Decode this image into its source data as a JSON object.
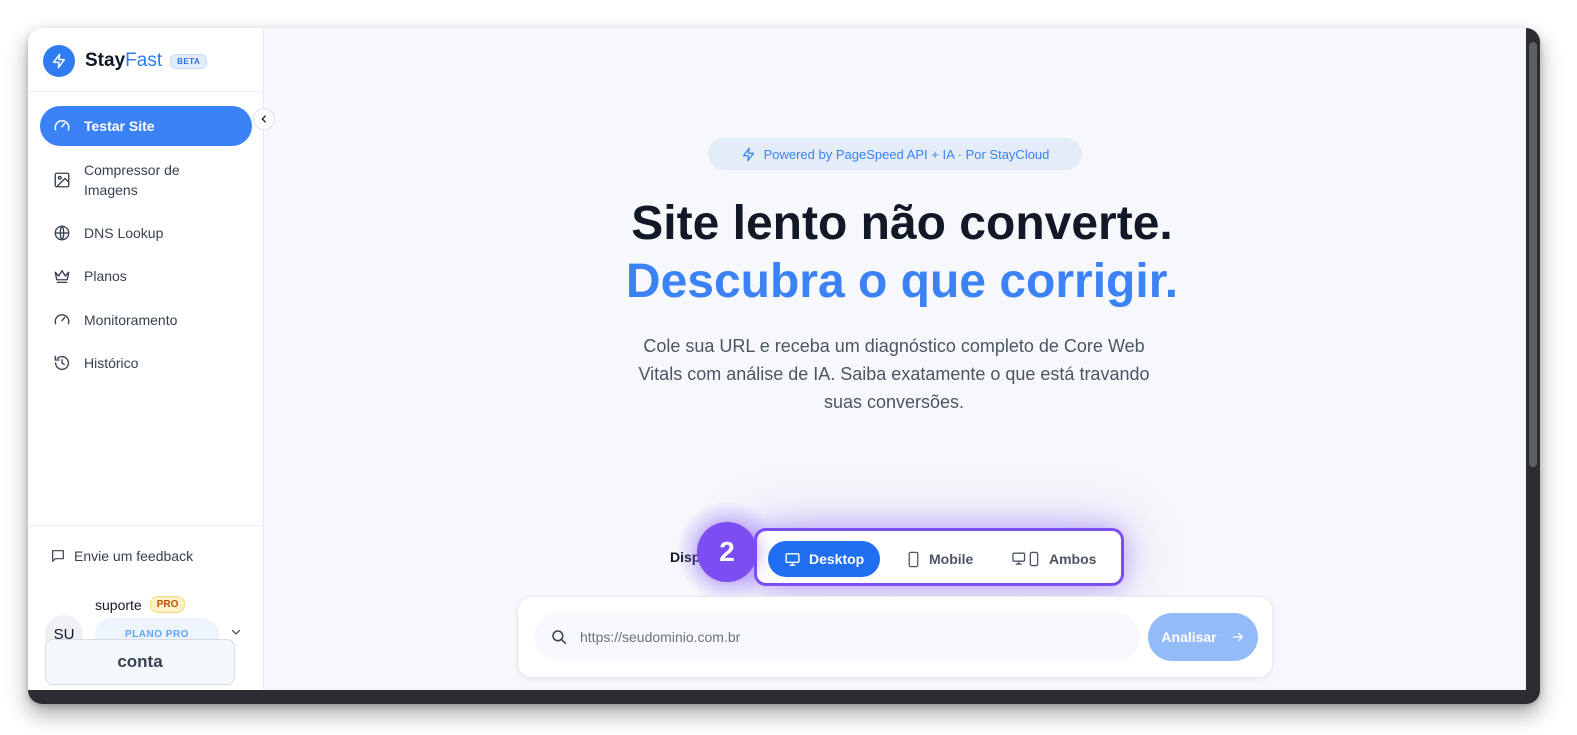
{
  "brand": {
    "name_part1": "Stay",
    "name_part2": "Fast",
    "badge": "BETA"
  },
  "sidebar": {
    "items": [
      {
        "label": "Testar Site",
        "icon": "gauge-icon",
        "active": true
      },
      {
        "label": "Compressor de Imagens",
        "icon": "image-icon",
        "active": false
      },
      {
        "label": "DNS Lookup",
        "icon": "globe-icon",
        "active": false
      },
      {
        "label": "Planos",
        "icon": "crown-icon",
        "active": false
      },
      {
        "label": "Monitoramento",
        "icon": "gauge-icon",
        "active": false
      },
      {
        "label": "Histórico",
        "icon": "history-icon",
        "active": false
      }
    ],
    "feedback_label": "Envie um feedback",
    "user": {
      "name": "suporte",
      "plan_badge": "PRO",
      "initials": "SU",
      "plan_label": "PLANO PRO"
    },
    "account_button": "conta"
  },
  "hero": {
    "powered_by": "Powered by PageSpeed API + IA · Por StayCloud",
    "headline_1": "Site lento não converte.",
    "headline_2": "Descubra o que corrigir.",
    "description": "Cole sua URL e receba um diagnóstico completo de Core Web Vitals com análise de IA. Saiba exatamente o que está travando suas conversões."
  },
  "device": {
    "label": "Disp",
    "step_number": "2",
    "options": [
      {
        "label": "Desktop",
        "icon": "monitor-icon",
        "active": true
      },
      {
        "label": "Mobile",
        "icon": "phone-icon",
        "active": false
      },
      {
        "label": "Ambos",
        "icon": "monitor-phone-icon",
        "active": false
      }
    ]
  },
  "search": {
    "placeholder": "https://seudominio.com.br",
    "button_label": "Analisar"
  },
  "colors": {
    "accent": "#3b82f6",
    "highlight": "#7c4df1",
    "active_segment": "#1f6ff0"
  }
}
